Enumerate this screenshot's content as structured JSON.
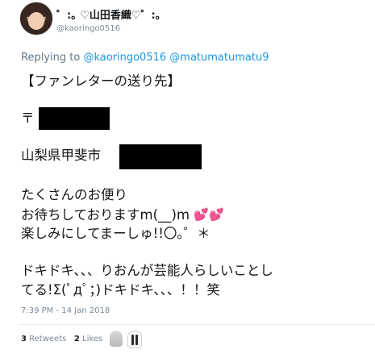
{
  "author": {
    "display_name": "゜:｡ ♡山田香織♡゜:｡",
    "handle": "@kaoringo0516",
    "avatar_icon": "avatar-photo"
  },
  "reply": {
    "prefix": "Replying to",
    "mentions": [
      "@kaoringo0516",
      "@matumatumatu9"
    ]
  },
  "tweet": {
    "line1": "【ファンレターの送り先】",
    "line2": "〒",
    "line3": "山梨県甲斐市",
    "line4": "たくさんのお便り",
    "line5": "お待ちしておりますm(__)m",
    "line6": "楽しみにしてまーしゅ!!〇｡゜＊",
    "line7": "ドキドキ、、、りおんが芸能人らしいことし",
    "line8": "てる!Σ(ﾟдﾟ；)ドキドキ、、、！！笑",
    "hearts": "💕💕"
  },
  "timestamp": "7:39 PM - 14 Jan 2018",
  "stats": {
    "retweets_count": "3",
    "retweets_label": "Retweets",
    "likes_count": "2",
    "likes_label": "Likes"
  },
  "colors": {
    "link": "#1b95e0",
    "meta_gray": "#657786",
    "text": "#14171a"
  }
}
